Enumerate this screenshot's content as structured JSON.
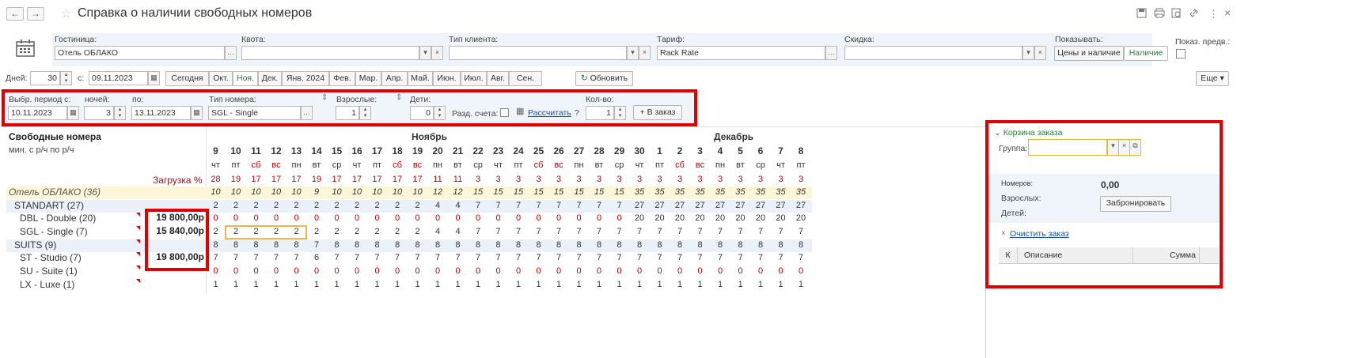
{
  "window": {
    "title": "Справка о наличии свободных номеров",
    "back_icon": "←",
    "forward_icon": "→",
    "more_icon": "⋮",
    "close_icon": "×"
  },
  "params": {
    "hotel_label": "Гостиница:",
    "hotel_value": "Отель ОБЛАКО",
    "quota_label": "Квота:",
    "quota_value": "",
    "client_type_label": "Тип клиента:",
    "client_type_value": "",
    "tariff_label": "Тариф:",
    "tariff_value": "Rack Rate",
    "discount_label": "Скидка:",
    "discount_value": "",
    "show_label": "Показывать:",
    "show_options": [
      "Цены и наличие",
      "Наличие"
    ],
    "show_prev_label": "Показ. предв.:"
  },
  "period": {
    "days_label": "Дней:",
    "days_value": "30",
    "from_label": "с:",
    "from_value": "09.11.2023",
    "months": [
      "Сегодня",
      "Окт.",
      "Ноя.",
      "Дек.",
      "Янв. 2024",
      "Фев.",
      "Мар.",
      "Апр.",
      "Май.",
      "Июн.",
      "Июл.",
      "Авг.",
      "Сен."
    ],
    "active_month": "Ноя.",
    "refresh_label": "Обновить",
    "more_label": "Еще"
  },
  "filter": {
    "period_label": "Выбр. период с:",
    "period_value": "10.11.2023",
    "nights_label": "ночей:",
    "nights_value": "3",
    "to_label": "по:",
    "to_value": "13.11.2023",
    "room_type_label": "Тип номера:",
    "room_type_value": "SGL - Single",
    "adults_label": "Взрослые:",
    "adults_value": "1",
    "children_label": "Дети:",
    "children_value": "0",
    "split_label": "Разд. счета:",
    "calc_label": "Рассчитать",
    "help": "?",
    "qty_label": "Кол-во:",
    "qty_value": "1",
    "order_label": "В заказ"
  },
  "grid": {
    "title": "Свободные номера",
    "subtitle": "мин. с р/ч по р/ч",
    "load_label": "Загрузка %",
    "months": [
      "Ноябрь",
      "Декабрь"
    ],
    "days": [
      "9",
      "10",
      "11",
      "12",
      "13",
      "14",
      "15",
      "16",
      "17",
      "18",
      "19",
      "20",
      "21",
      "22",
      "23",
      "24",
      "25",
      "26",
      "27",
      "28",
      "29",
      "30",
      "1",
      "2",
      "3",
      "4",
      "5",
      "6",
      "7",
      "8"
    ],
    "weekdays": [
      "чт",
      "пт",
      "сб",
      "вс",
      "пн",
      "вт",
      "ср",
      "чт",
      "пт",
      "сб",
      "вс",
      "пн",
      "вт",
      "ср",
      "чт",
      "пт",
      "сб",
      "вс",
      "пн",
      "вт",
      "ср",
      "чт",
      "пт",
      "сб",
      "вс",
      "пн",
      "вт",
      "ср",
      "чт",
      "пт"
    ],
    "load": [
      "28",
      "19",
      "17",
      "17",
      "17",
      "19",
      "17",
      "17",
      "17",
      "17",
      "17",
      "11",
      "11",
      "3",
      "3",
      "3",
      "3",
      "3",
      "3",
      "3",
      "3",
      "3",
      "3",
      "3",
      "3",
      "3",
      "3",
      "3",
      "3",
      "3"
    ],
    "rows": [
      {
        "label": "Отель ОБЛАКО (36)",
        "kind": "hotel",
        "price": "",
        "values": [
          "10",
          "10",
          "10",
          "10",
          "10",
          "9",
          "10",
          "10",
          "10",
          "10",
          "10",
          "12",
          "12",
          "15",
          "15",
          "15",
          "15",
          "15",
          "15",
          "15",
          "15",
          "35",
          "35",
          "35",
          "35",
          "35",
          "35",
          "35",
          "35",
          "35"
        ]
      },
      {
        "label": "STANDART (27)",
        "kind": "group",
        "price": "",
        "values": [
          "2",
          "2",
          "2",
          "2",
          "2",
          "2",
          "2",
          "2",
          "2",
          "2",
          "2",
          "4",
          "4",
          "7",
          "7",
          "7",
          "7",
          "7",
          "7",
          "7",
          "7",
          "27",
          "27",
          "27",
          "27",
          "27",
          "27",
          "27",
          "27",
          "27"
        ]
      },
      {
        "label": "DBL - Double (20)",
        "kind": "room",
        "price": "19 800,00р",
        "values": [
          "0",
          "0",
          "0",
          "0",
          "0",
          "0",
          "0",
          "0",
          "0",
          "0",
          "0",
          "0",
          "0",
          "0",
          "0",
          "0",
          "0",
          "0",
          "0",
          "0",
          "0",
          "20",
          "20",
          "20",
          "20",
          "20",
          "20",
          "20",
          "20",
          "20"
        ]
      },
      {
        "label": "SGL - Single (7)",
        "kind": "room",
        "price": "15 840,00р",
        "values": [
          "2",
          "2",
          "2",
          "2",
          "2",
          "2",
          "2",
          "2",
          "2",
          "2",
          "2",
          "4",
          "4",
          "7",
          "7",
          "7",
          "7",
          "7",
          "7",
          "7",
          "7",
          "7",
          "7",
          "7",
          "7",
          "7",
          "7",
          "7",
          "7",
          "7"
        ]
      },
      {
        "label": "SUITS (9)",
        "kind": "group",
        "price": "",
        "values": [
          "8",
          "8",
          "8",
          "8",
          "8",
          "7",
          "8",
          "8",
          "8",
          "8",
          "8",
          "8",
          "8",
          "8",
          "8",
          "8",
          "8",
          "8",
          "8",
          "8",
          "8",
          "8",
          "8",
          "8",
          "8",
          "8",
          "8",
          "8",
          "8",
          "8"
        ]
      },
      {
        "label": "ST - Studio (7)",
        "kind": "room",
        "price": "19 800,00р",
        "values": [
          "7",
          "7",
          "7",
          "7",
          "7",
          "6",
          "7",
          "7",
          "7",
          "7",
          "7",
          "7",
          "7",
          "7",
          "7",
          "7",
          "7",
          "7",
          "7",
          "7",
          "7",
          "7",
          "7",
          "7",
          "7",
          "7",
          "7",
          "7",
          "7",
          "7"
        ]
      },
      {
        "label": "SU - Suite (1)",
        "kind": "room",
        "price": "",
        "values": [
          "0",
          "0",
          "0",
          "0",
          "0",
          "0",
          "0",
          "0",
          "0",
          "0",
          "0",
          "0",
          "0",
          "0",
          "0",
          "0",
          "0",
          "0",
          "0",
          "0",
          "0",
          "0",
          "0",
          "0",
          "0",
          "0",
          "0",
          "0",
          "0",
          "0"
        ]
      },
      {
        "label": "LX - Luxe (1)",
        "kind": "room",
        "price": "",
        "values": [
          "1",
          "1",
          "1",
          "1",
          "1",
          "1",
          "1",
          "1",
          "1",
          "1",
          "1",
          "1",
          "1",
          "1",
          "1",
          "1",
          "1",
          "1",
          "1",
          "1",
          "1",
          "1",
          "1",
          "1",
          "1",
          "1",
          "1",
          "1",
          "1",
          "1"
        ]
      }
    ]
  },
  "cart": {
    "title": "Корзина заказа",
    "group_label": "Группа:",
    "group_value": "",
    "rooms_label": "Номеров:",
    "rooms_value": "0,00",
    "adults_label": "Взрослых:",
    "children_label": "Детей:",
    "book_label": "Забронировать",
    "clear_label": "Очистить заказ",
    "table_headers": [
      "К",
      "Описание",
      "Сумма"
    ]
  }
}
